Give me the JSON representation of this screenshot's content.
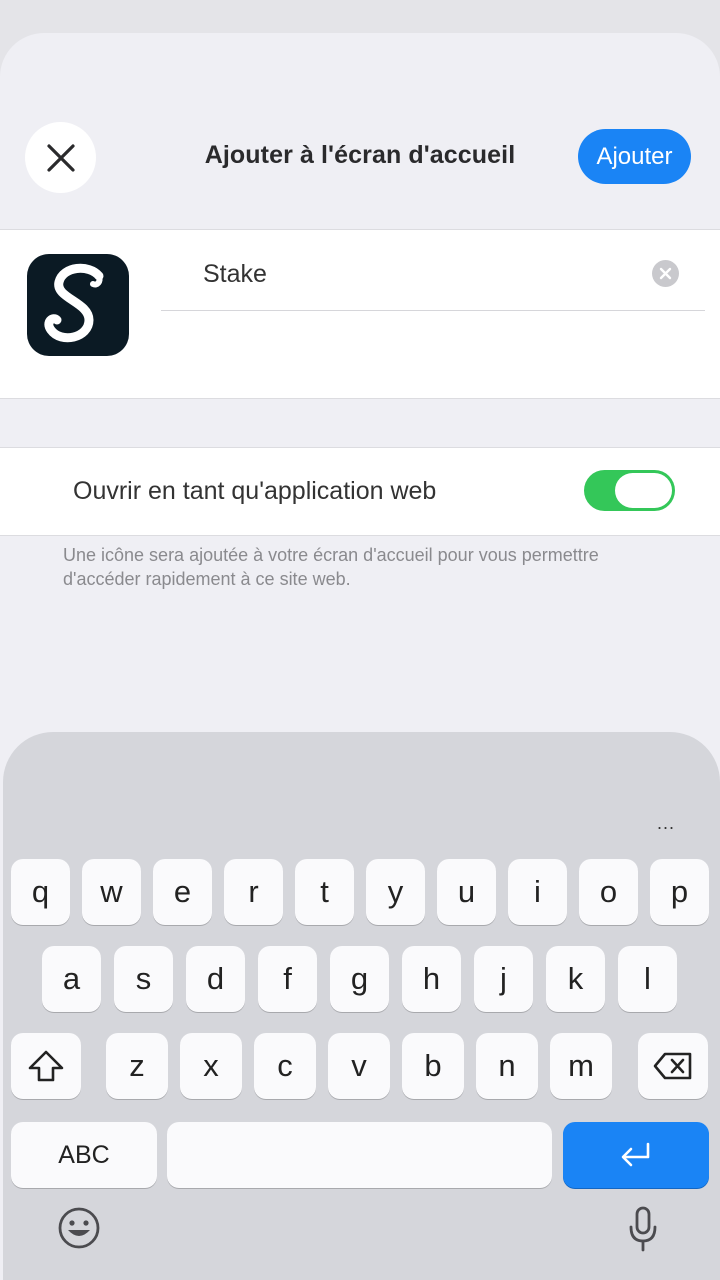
{
  "header": {
    "title": "Ajouter à l'écran d'accueil",
    "add_label": "Ajouter",
    "close_icon": "close-icon"
  },
  "app": {
    "icon": "stake-app-icon",
    "icon_letter": "S",
    "name_value": "Stake"
  },
  "web_app": {
    "label": "Ouvrir en tant qu'application web",
    "enabled": true
  },
  "description": "Une icône sera ajoutée à votre écran d'accueil pour vous permettre d'accéder rapidement à ce site web.",
  "keyboard": {
    "more": "...",
    "row1": [
      "q",
      "w",
      "e",
      "r",
      "t",
      "y",
      "u",
      "i",
      "o",
      "p"
    ],
    "row2": [
      "a",
      "s",
      "d",
      "f",
      "g",
      "h",
      "j",
      "k",
      "l"
    ],
    "row3": [
      "z",
      "x",
      "c",
      "v",
      "b",
      "n",
      "m"
    ],
    "abc_label": "ABC",
    "colors": {
      "return": "#1a84f5",
      "toggle": "#34c759"
    }
  }
}
